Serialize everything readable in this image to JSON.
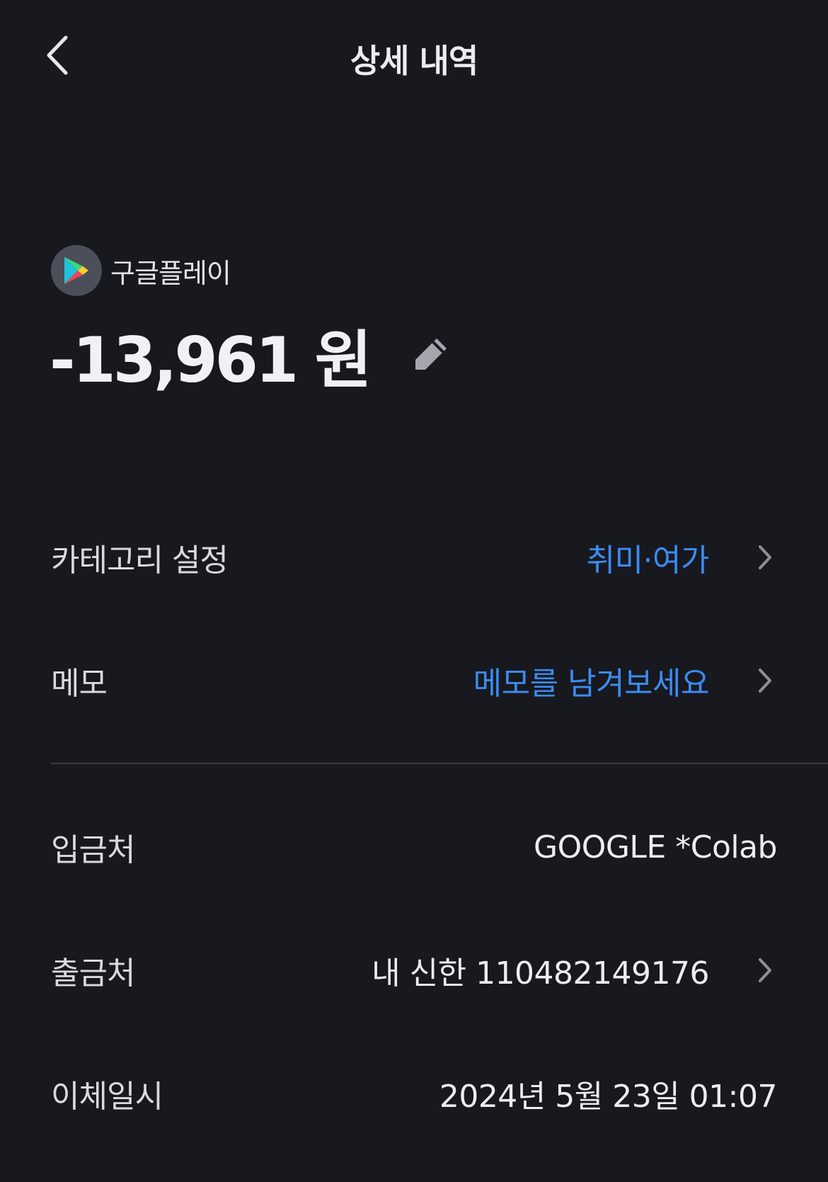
{
  "header": {
    "title": "상세 내역"
  },
  "merchant": {
    "name": "구글플레이",
    "logo_icon": "google-play-icon",
    "amount": "-13,961 원"
  },
  "rows": {
    "category": {
      "label": "카테고리 설정",
      "value": "취미·여가"
    },
    "memo": {
      "label": "메모",
      "value": "메모를 남겨보세요"
    },
    "payee": {
      "label": "입금처",
      "value": "GOOGLE *Colab"
    },
    "account": {
      "label": "출금처",
      "value": "내 신한 110482149176"
    },
    "datetime": {
      "label": "이체일시",
      "value": "2024년 5월 23일 01:07"
    }
  },
  "colors": {
    "background": "#18181f",
    "accent": "#3a8cf0",
    "text": "#ececf1"
  }
}
